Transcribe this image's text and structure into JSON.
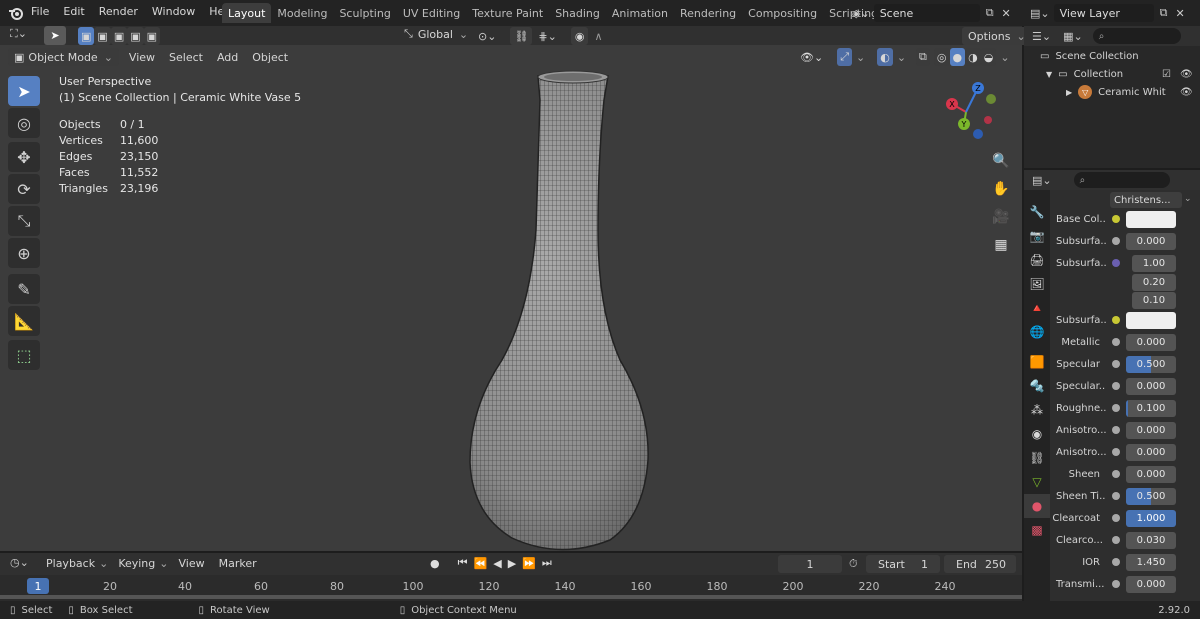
{
  "topbar": {
    "menu": [
      "File",
      "Edit",
      "Render",
      "Window",
      "Help"
    ],
    "workspaces": [
      "Layout",
      "Modeling",
      "Sculpting",
      "UV Editing",
      "Texture Paint",
      "Shading",
      "Animation",
      "Rendering",
      "Compositing",
      "Scripting"
    ],
    "active_workspace": "Layout",
    "add_tab": "+",
    "scene": "Scene",
    "view_layer": "View Layer"
  },
  "viewport_header": {
    "mode": "Object Mode",
    "menus": [
      "View",
      "Select",
      "Add",
      "Object"
    ],
    "orientation": "Global",
    "options": "Options"
  },
  "viewport": {
    "perspective": "User Perspective",
    "collection_path": "(1) Scene Collection | Ceramic White Vase 5",
    "stats": [
      {
        "label": "Objects",
        "value": "0 / 1"
      },
      {
        "label": "Vertices",
        "value": "11,600"
      },
      {
        "label": "Edges",
        "value": "23,150"
      },
      {
        "label": "Faces",
        "value": "11,552"
      },
      {
        "label": "Triangles",
        "value": "23,196"
      }
    ],
    "gizmo": {
      "x": "X",
      "y": "Y",
      "z": "Z"
    }
  },
  "timeline": {
    "menus": [
      "Playback",
      "Keying",
      "View",
      "Marker"
    ],
    "current_frame": "1",
    "start_label": "Start",
    "start": "1",
    "end_label": "End",
    "end": "250",
    "ticks": [
      "1",
      "20",
      "40",
      "60",
      "80",
      "100",
      "120",
      "140",
      "160",
      "180",
      "200",
      "220",
      "240"
    ]
  },
  "statusbar": {
    "select": "Select",
    "box_select": "Box Select",
    "rotate_view": "Rotate View",
    "context_menu": "Object Context Menu",
    "version": "2.92.0"
  },
  "outliner": {
    "scene_collection": "Scene Collection",
    "collection": "Collection",
    "object": "Ceramic Whit"
  },
  "properties": {
    "shader": "Christens...",
    "rows": [
      {
        "label": "Base Col...",
        "value": "",
        "kind": "white",
        "dot": "#c8c834"
      },
      {
        "label": "Subsurfa...",
        "value": "0.000",
        "kind": "num"
      },
      {
        "label": "Subsurfa...",
        "value": "1.00",
        "kind": "num",
        "dot": "#6a5fb0"
      },
      {
        "label": "",
        "value": "0.20",
        "kind": "num"
      },
      {
        "label": "",
        "value": "0.10",
        "kind": "num"
      },
      {
        "label": "Subsurfa...",
        "value": "",
        "kind": "white",
        "dot": "#c8c834"
      },
      {
        "label": "Metallic",
        "value": "0.000",
        "kind": "num"
      },
      {
        "label": "Specular",
        "value": "0.500",
        "kind": "blue"
      },
      {
        "label": "Specular...",
        "value": "0.000",
        "kind": "num"
      },
      {
        "label": "Roughne...",
        "value": "0.100",
        "kind": "num"
      },
      {
        "label": "Anisotro...",
        "value": "0.000",
        "kind": "num"
      },
      {
        "label": "Anisotro...",
        "value": "0.000",
        "kind": "num"
      },
      {
        "label": "Sheen",
        "value": "0.000",
        "kind": "num"
      },
      {
        "label": "Sheen Ti...",
        "value": "0.500",
        "kind": "blue"
      },
      {
        "label": "Clearcoat",
        "value": "1.000",
        "kind": "blue"
      },
      {
        "label": "Clearco...",
        "value": "0.030",
        "kind": "num"
      },
      {
        "label": "IOR",
        "value": "1.450",
        "kind": "num"
      },
      {
        "label": "Transmi...",
        "value": "0.000",
        "kind": "num"
      }
    ]
  },
  "colors": {
    "accent": "#4772b3",
    "viewport_bg": "#3c3c3c",
    "gizmo_x": "#d9364c",
    "gizmo_y": "#7cb82b",
    "gizmo_z": "#3a78d8"
  }
}
